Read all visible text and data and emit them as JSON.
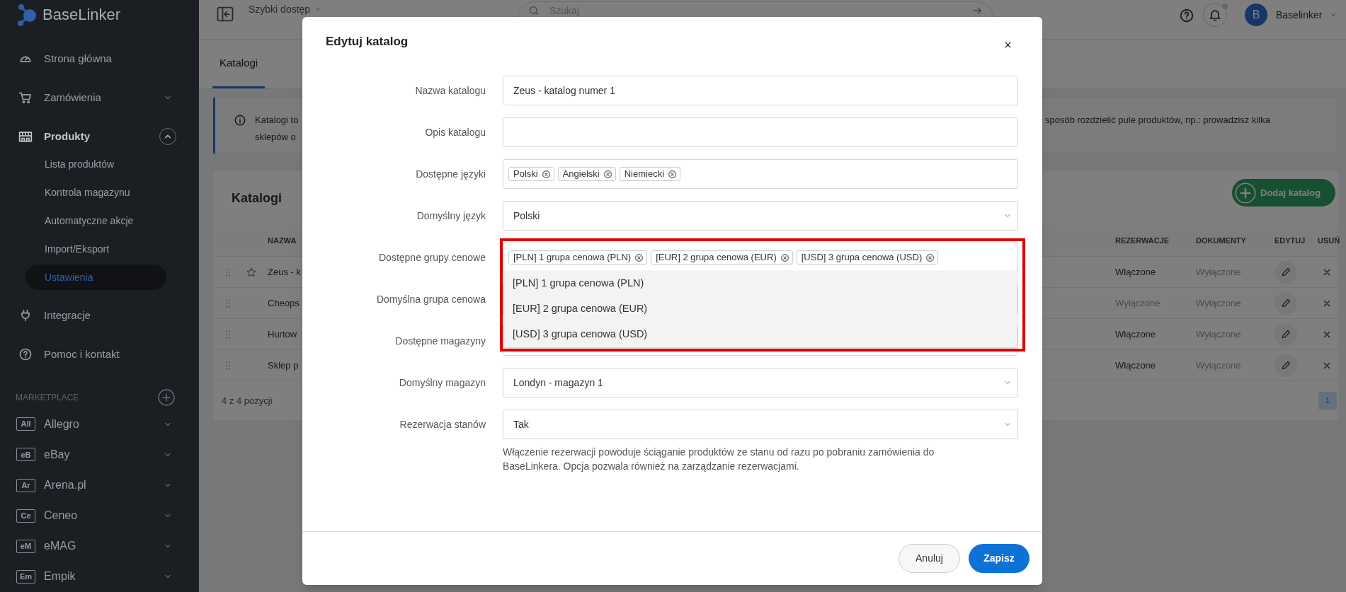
{
  "sidebar": {
    "logo": "BaseLinker",
    "items": [
      {
        "label": "Strona główna",
        "kind": "link"
      },
      {
        "label": "Zamówienia",
        "kind": "group",
        "expanded": false
      },
      {
        "label": "Produkty",
        "kind": "group",
        "expanded": true,
        "children": [
          {
            "label": "Lista produktów",
            "selected": false
          },
          {
            "label": "Kontrola magazynu",
            "selected": false
          },
          {
            "label": "Automatyczne akcje",
            "selected": false
          },
          {
            "label": "Import/Eksport",
            "selected": false
          },
          {
            "label": "Ustawienia",
            "selected": true
          }
        ]
      },
      {
        "label": "Integracje",
        "kind": "link"
      },
      {
        "label": "Pomoc i kontakt",
        "kind": "link"
      }
    ],
    "marketplace": {
      "title": "MARKETPLACE",
      "items": [
        {
          "badge": "All",
          "label": "Allegro"
        },
        {
          "badge": "eB",
          "label": "eBay"
        },
        {
          "badge": "Ar",
          "label": "Arena.pl"
        },
        {
          "badge": "Ce",
          "label": "Ceneo"
        },
        {
          "badge": "eM",
          "label": "eMAG"
        },
        {
          "badge": "Em",
          "label": "Empik"
        }
      ]
    }
  },
  "topbar": {
    "quick_access": "Szybki dostęp",
    "search": {
      "placeholder": "Szukaj"
    },
    "avatar": "B",
    "user": "Baselinker"
  },
  "tabs": [
    {
      "label": "Katalogi",
      "selected": true
    }
  ],
  "info": {
    "text_left": [
      "Katalogi to",
      "sklepów o"
    ],
    "text_right": [
      "sposób rozdzielić pule produktów, np.: prowadzisz kilka"
    ]
  },
  "catalogs": {
    "title": "Katalogi",
    "add_button": "Dodaj katalog",
    "columns": [
      "NAZWA",
      "REZERWACJE",
      "DOKUMENTY",
      "EDYTUJ",
      "USUŃ"
    ],
    "rows": [
      {
        "name": "Zeus - k",
        "default": true,
        "reservations": {
          "text": "Włączone",
          "on": true
        },
        "documents": {
          "text": "Wyłączone",
          "on": false
        }
      },
      {
        "name": "Cheops",
        "default": false,
        "reservations": {
          "text": "Wyłączone",
          "on": false
        },
        "documents": {
          "text": "Wyłączone",
          "on": false
        }
      },
      {
        "name": "Hurtow",
        "default": false,
        "reservations": {
          "text": "Włączone",
          "on": true
        },
        "documents": {
          "text": "Wyłączone",
          "on": false
        }
      },
      {
        "name": "Sklep p",
        "default": false,
        "reservations": {
          "text": "Włączone",
          "on": true
        },
        "documents": {
          "text": "Wyłączone",
          "on": false
        }
      }
    ],
    "summary": "4 z 4 pozycji",
    "pages": [
      {
        "label": "1",
        "selected": true
      }
    ]
  },
  "modal": {
    "title": "Edytuj katalog",
    "fields": [
      {
        "label": "Nazwa katalogu",
        "kind": "text",
        "value": "Zeus - katalog numer 1",
        "highlighted": false
      },
      {
        "label": "Opis katalogu",
        "kind": "text",
        "highlighted": false
      },
      {
        "label": "Dostępne języki",
        "kind": "tags",
        "tags": [
          "Polski",
          "Angielski",
          "Niemiecki"
        ],
        "expanded": false,
        "highlighted": false
      },
      {
        "label": "Domyślny język",
        "kind": "select",
        "value": "Polski",
        "highlighted": false
      },
      {
        "label": "Dostępne grupy cenowe",
        "kind": "tags",
        "tags": [
          "[PLN] 1 grupa cenowa (PLN)",
          "[EUR] 2 grupa cenowa (EUR)",
          "[USD] 3 grupa cenowa (USD)"
        ],
        "expanded": true,
        "options": [
          "[PLN] 1 grupa cenowa (PLN)",
          "[EUR] 2 grupa cenowa (EUR)",
          "[USD] 3 grupa cenowa (USD)"
        ],
        "highlighted": true
      },
      {
        "label": "Domyślna grupa cenowa",
        "kind": "select",
        "highlighted": false
      },
      {
        "label": "Dostępne magazyny",
        "kind": "tags",
        "expanded": false,
        "highlighted": false
      },
      {
        "label": "Domyślny magazyn",
        "kind": "select",
        "value": "Londyn - magazyn 1",
        "highlighted": false
      },
      {
        "label": "Rezerwacja stanów",
        "kind": "select",
        "value": "Tak",
        "help": "Włączenie rezerwacji powoduje ściąganie produktów ze stanu od razu po pobraniu zamówienia do BaseLinkera. Opcja pozwala również na zarządzanie rezerwacjami.",
        "highlighted": false
      }
    ],
    "buttons": {
      "cancel": "Anuluj",
      "save": "Zapisz"
    }
  }
}
